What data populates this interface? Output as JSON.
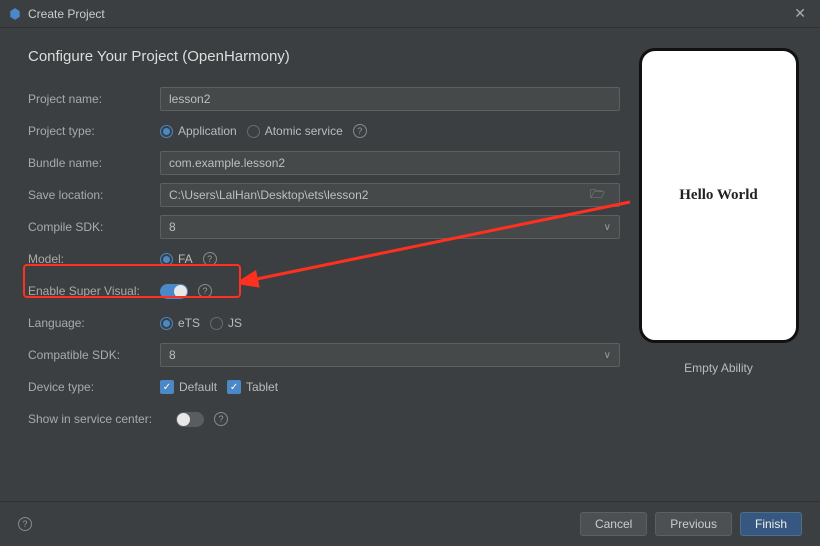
{
  "window": {
    "title": "Create Project"
  },
  "heading": "Configure Your Project (OpenHarmony)",
  "form": {
    "project_name": {
      "label": "Project name:",
      "value": "lesson2"
    },
    "project_type": {
      "label": "Project type:",
      "options": {
        "application": "Application",
        "atomic": "Atomic service"
      }
    },
    "bundle_name": {
      "label": "Bundle name:",
      "value": "com.example.lesson2"
    },
    "save_location": {
      "label": "Save location:",
      "value": "C:\\Users\\LalHan\\Desktop\\ets\\lesson2"
    },
    "compile_sdk": {
      "label": "Compile SDK:",
      "value": "8"
    },
    "model": {
      "label": "Model:",
      "option_fa": "FA"
    },
    "enable_super_visual": {
      "label": "Enable Super Visual:"
    },
    "language": {
      "label": "Language:",
      "ets": "eTS",
      "js": "JS"
    },
    "compatible_sdk": {
      "label": "Compatible SDK:",
      "value": "8"
    },
    "device_type": {
      "label": "Device type:",
      "default": "Default",
      "tablet": "Tablet"
    },
    "show_in_service": {
      "label": "Show in service center:"
    }
  },
  "preview": {
    "text": "Hello World",
    "caption": "Empty Ability"
  },
  "footer": {
    "cancel": "Cancel",
    "previous": "Previous",
    "finish": "Finish"
  }
}
